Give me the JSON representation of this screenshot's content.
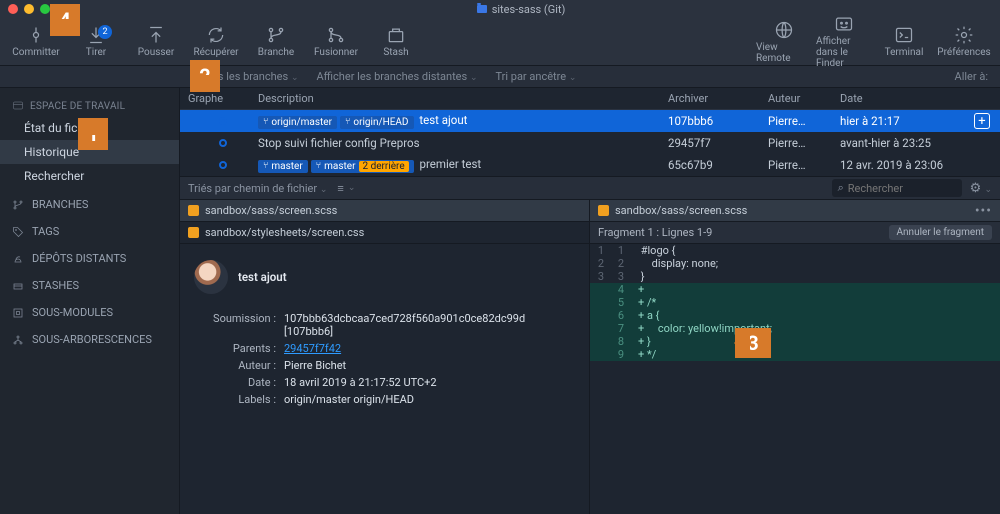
{
  "window": {
    "title": "sites-sass (Git)"
  },
  "toolbar": {
    "left": [
      {
        "id": "commit",
        "label": "Committer"
      },
      {
        "id": "pull",
        "label": "Tirer",
        "badge": "2"
      },
      {
        "id": "push",
        "label": "Pousser"
      },
      {
        "id": "fetch",
        "label": "Récupérer"
      },
      {
        "id": "branch",
        "label": "Branche"
      },
      {
        "id": "merge",
        "label": "Fusionner"
      },
      {
        "id": "stash",
        "label": "Stash"
      }
    ],
    "right": [
      {
        "id": "view-remote",
        "label": "View Remote"
      },
      {
        "id": "finder",
        "label": "Afficher dans le Finder"
      },
      {
        "id": "terminal",
        "label": "Terminal"
      },
      {
        "id": "prefs",
        "label": "Préférences"
      }
    ]
  },
  "filterrow": {
    "all_branches": "Toutes les branches",
    "remote": "Afficher les branches distantes",
    "sort": "Tri par ancêtre",
    "goto": "Aller à:"
  },
  "sidebar": {
    "workspace_head": "ESPACE DE TRAVAIL",
    "workspace": [
      {
        "id": "file-status",
        "label": "État du fichier"
      },
      {
        "id": "history",
        "label": "Historique",
        "active": true
      },
      {
        "id": "search",
        "label": "Rechercher"
      }
    ],
    "sections": [
      {
        "id": "branches",
        "label": "BRANCHES"
      },
      {
        "id": "tags",
        "label": "TAGS"
      },
      {
        "id": "remotes",
        "label": "DÉPÔTS DISTANTS"
      },
      {
        "id": "stashes",
        "label": "STASHES"
      },
      {
        "id": "submodules",
        "label": "SOUS-MODULES"
      },
      {
        "id": "subtrees",
        "label": "SOUS-ARBORESCENCES"
      }
    ]
  },
  "history": {
    "headers": {
      "graph": "Graphe",
      "desc": "Description",
      "arch": "Archiver",
      "auth": "Auteur",
      "date": "Date"
    },
    "rows": [
      {
        "selected": true,
        "refs": [
          "origin/master",
          "origin/HEAD"
        ],
        "msg": "test ajout",
        "hash": "107bbb6",
        "author": "Pierre…",
        "date": "hier à 21:17",
        "plus": true
      },
      {
        "refs": [],
        "msg": "Stop suivi fichier config Prepros",
        "hash": "29457f7",
        "author": "Pierre…",
        "date": "avant-hier à 23:25"
      },
      {
        "refs": [
          "master"
        ],
        "behind": "2 derrière",
        "msg": "premier test",
        "hash": "65c67b9",
        "author": "Pierre…",
        "date": "12 avr. 2019 à 23:06"
      }
    ]
  },
  "midbar": {
    "sort": "Triés par chemin de fichier",
    "view": "≡",
    "search_placeholder": "Rechercher"
  },
  "files": {
    "left": [
      {
        "path": "sandbox/sass/screen.scss",
        "active": true
      },
      {
        "path": "sandbox/stylesheets/screen.css"
      }
    ],
    "right": {
      "path": "sandbox/sass/screen.scss"
    }
  },
  "commit": {
    "message": "test ajout",
    "meta": {
      "submission_k": "Soumission :",
      "submission_v": "107bbb63dcbcaa7ced728f560a901c0ce82dc99d [107bbb6]",
      "parents_k": "Parents :",
      "parents_v": "29457f7f42",
      "author_k": "Auteur :",
      "author_v": "Pierre Bichet",
      "date_k": "Date :",
      "date_v": "18 avril 2019 à 21:17:52 UTC+2",
      "labels_k": "Labels :",
      "labels_v": "origin/master origin/HEAD"
    }
  },
  "diff": {
    "hunk_title": "Fragment 1 : Lignes 1-9",
    "undo": "Annuler le fragment",
    "lines": [
      {
        "o": "1",
        "n": "1",
        "t": " #logo {",
        "add": false
      },
      {
        "o": "2",
        "n": "2",
        "t": "     display: none;",
        "add": false
      },
      {
        "o": "3",
        "n": "3",
        "t": " }",
        "add": false
      },
      {
        "o": "",
        "n": "4",
        "t": "+",
        "add": true
      },
      {
        "o": "",
        "n": "5",
        "t": "+ /*",
        "add": true
      },
      {
        "o": "",
        "n": "6",
        "t": "+ a {",
        "add": true
      },
      {
        "o": "",
        "n": "7",
        "t": "+     color: yellow!important;",
        "add": true
      },
      {
        "o": "",
        "n": "8",
        "t": "+ }",
        "add": true
      },
      {
        "o": "",
        "n": "9",
        "t": "+ */",
        "add": true
      }
    ]
  },
  "callouts": {
    "c1": "1",
    "c2": "2",
    "c3": "3",
    "c4": "4"
  }
}
